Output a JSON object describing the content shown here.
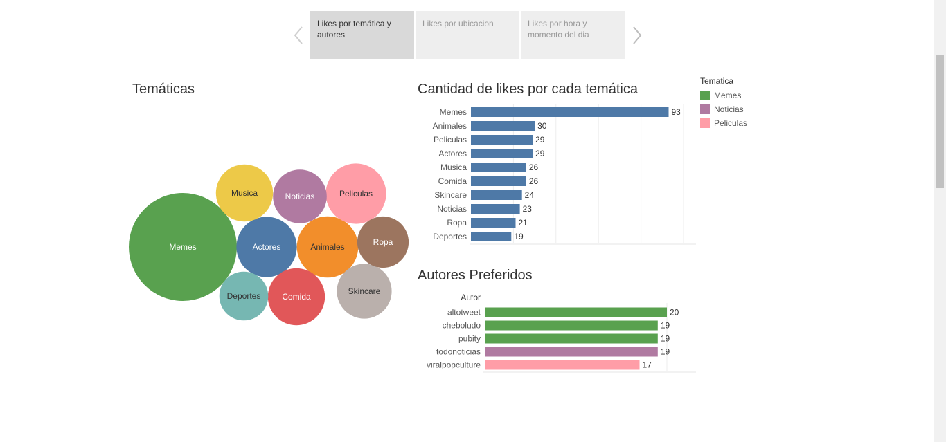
{
  "nav": {
    "tabs": [
      {
        "label": "Likes por temática y autores",
        "active": true
      },
      {
        "label": "Likes por ubicacion",
        "active": false
      },
      {
        "label": "Likes por hora y momento del dia",
        "active": false
      }
    ]
  },
  "colors": {
    "bar_blue": "#4e79a7",
    "Memes": "#59a14f",
    "Noticias": "#b07aa1",
    "Peliculas": "#ff9da7"
  },
  "bubble": {
    "title": "Temáticas"
  },
  "legend": {
    "title": "Tematica",
    "items": [
      {
        "label": "Memes",
        "color": "#59a14f"
      },
      {
        "label": "Noticias",
        "color": "#b07aa1"
      },
      {
        "label": "Peliculas",
        "color": "#ff9da7"
      }
    ]
  },
  "likes_chart": {
    "title": "Cantidad de likes por cada temática"
  },
  "authors_chart": {
    "title": "Autores Preferidos",
    "header": "Autor"
  },
  "chart_data": [
    {
      "type": "bubble",
      "title": "Temáticas",
      "bubbles": [
        {
          "label": "Memes",
          "value": 93,
          "color": "#59a14f"
        },
        {
          "label": "Animales",
          "value": 30,
          "color": "#f28e2b"
        },
        {
          "label": "Peliculas",
          "value": 29,
          "color": "#ff9da7"
        },
        {
          "label": "Actores",
          "value": 29,
          "color": "#4e79a7"
        },
        {
          "label": "Musica",
          "value": 26,
          "color": "#edc948"
        },
        {
          "label": "Comida",
          "value": 26,
          "color": "#e15759"
        },
        {
          "label": "Skincare",
          "value": 24,
          "color": "#bab0ac"
        },
        {
          "label": "Noticias",
          "value": 23,
          "color": "#b07aa1"
        },
        {
          "label": "Ropa",
          "value": 21,
          "color": "#9c755f"
        },
        {
          "label": "Deportes",
          "value": 19,
          "color": "#76b7b2"
        }
      ]
    },
    {
      "type": "bar",
      "orientation": "horizontal",
      "title": "Cantidad de likes por cada temática",
      "categories": [
        "Memes",
        "Animales",
        "Peliculas",
        "Actores",
        "Musica",
        "Comida",
        "Skincare",
        "Noticias",
        "Ropa",
        "Deportes"
      ],
      "values": [
        93,
        30,
        29,
        29,
        26,
        26,
        24,
        23,
        21,
        19
      ],
      "xlim": [
        0,
        100
      ],
      "grid": true
    },
    {
      "type": "bar",
      "orientation": "horizontal",
      "title": "Autores Preferidos",
      "header": "Autor",
      "categories": [
        "altotweet",
        "cheboludo",
        "pubity",
        "todonoticias",
        "viralpopculture"
      ],
      "values": [
        20,
        19,
        19,
        19,
        17
      ],
      "tematica": [
        "Memes",
        "Memes",
        "Memes",
        "Noticias",
        "Peliculas"
      ],
      "xlim": [
        0,
        20
      ],
      "grid": true
    }
  ]
}
